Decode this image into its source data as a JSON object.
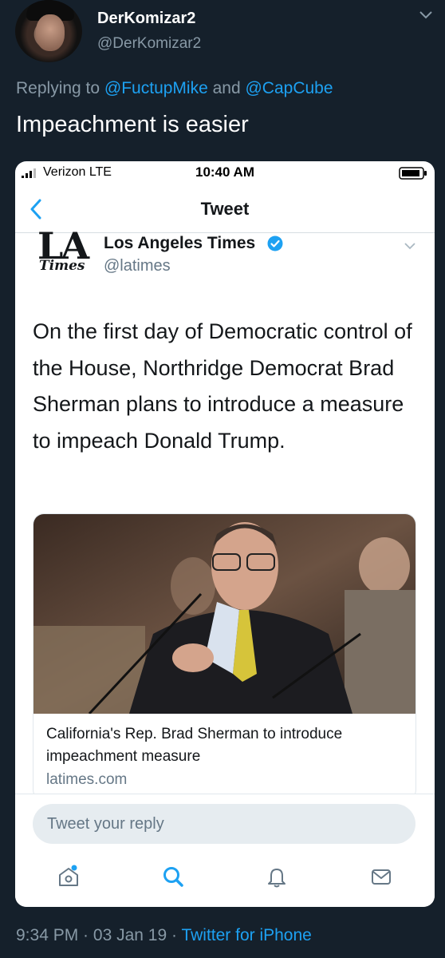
{
  "author": {
    "display_name": "DerKomizar2",
    "handle": "@DerKomizar2"
  },
  "reply_context": {
    "prefix": "Replying to ",
    "user1": "@FuctupMike",
    "joiner": " and ",
    "user2": "@CapCube"
  },
  "tweet": {
    "text": "Impeachment is easier",
    "time": "9:34 PM",
    "sep1": " · ",
    "date": "03 Jan 19",
    "sep2": " · ",
    "source": "Twitter for iPhone"
  },
  "screenshot": {
    "status_bar": {
      "carrier": "Verizon  LTE",
      "time": "10:40 AM"
    },
    "nav": {
      "title": "Tweet"
    },
    "quoted_tweet": {
      "logo_top": "LA",
      "logo_bottom": "Times",
      "name": "Los Angeles Times",
      "handle": "@latimes",
      "text": "On the first day of Democratic control of the House, Northridge Democrat Brad Sherman plans to introduce a measure to impeach Donald Trump."
    },
    "link_card": {
      "title": "California's Rep. Brad Sherman to introduce impeachment measure",
      "domain": "latimes.com"
    },
    "reply": {
      "placeholder": "Tweet your reply"
    },
    "tabs": [
      {
        "icon": "home-icon"
      },
      {
        "icon": "search-icon"
      },
      {
        "icon": "notifications-icon"
      },
      {
        "icon": "messages-icon"
      }
    ]
  },
  "colors": {
    "background": "#15202b",
    "accent": "#1da1f2",
    "secondary_text": "#8899a6"
  }
}
